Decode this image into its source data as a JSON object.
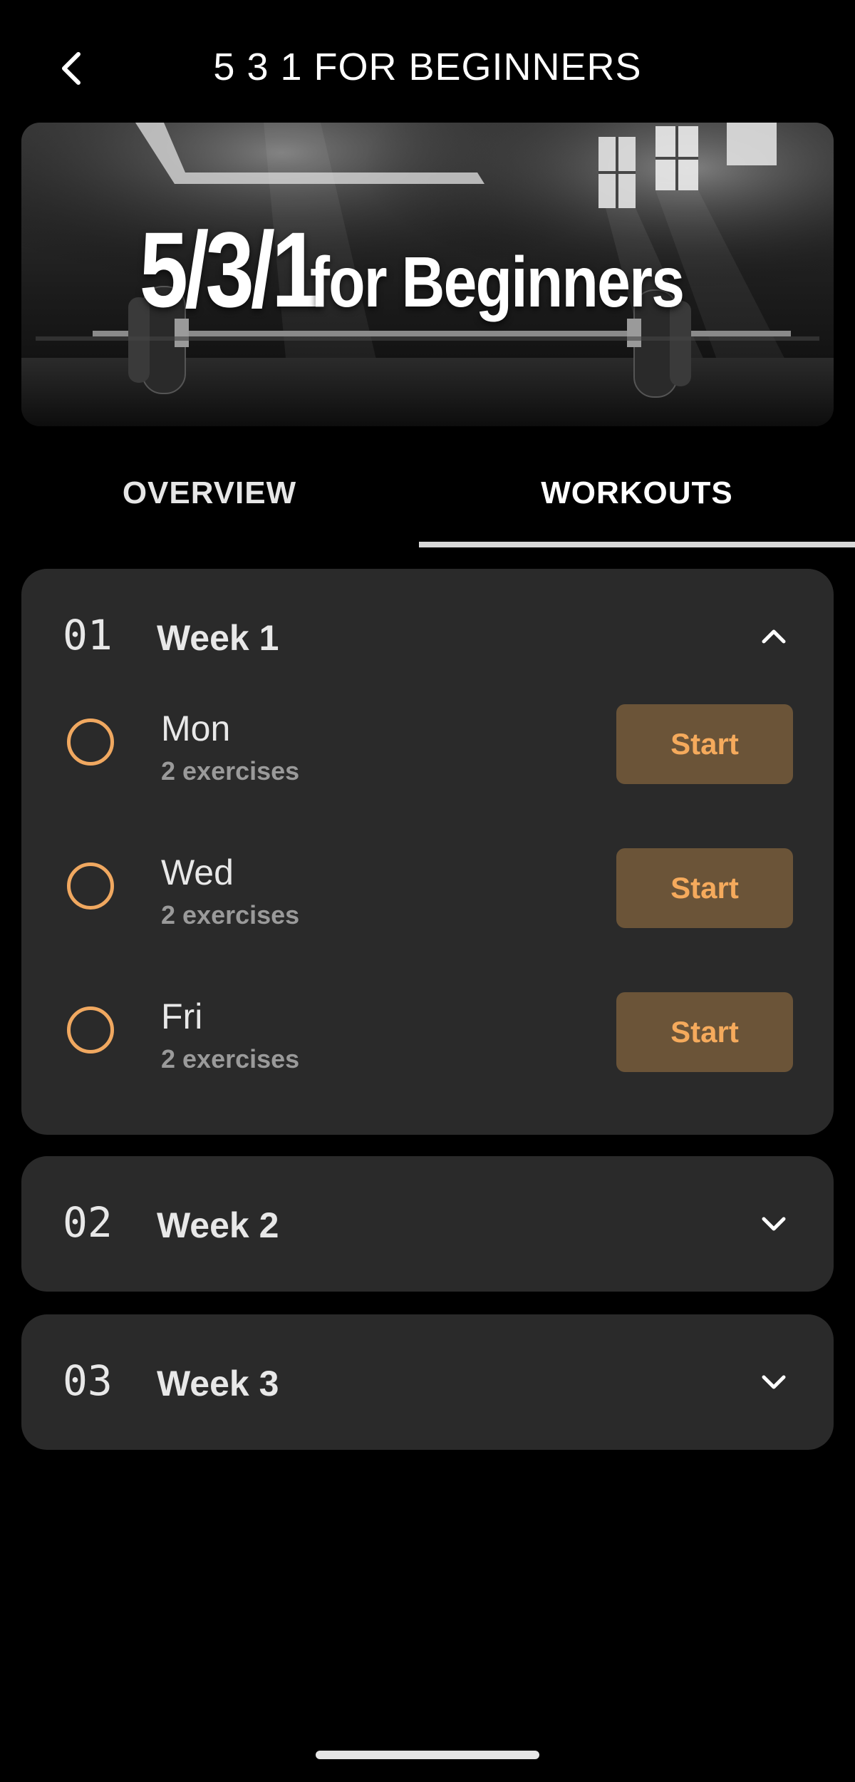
{
  "header": {
    "title": "5 3 1 FOR BEGINNERS",
    "back_icon": "chevron-left-icon"
  },
  "banner": {
    "big_text": "5/3/1",
    "small_text": "for Beginners",
    "image": "barbell-gym-photo"
  },
  "tabs": [
    {
      "label": "OVERVIEW",
      "selected": false
    },
    {
      "label": "WORKOUTS",
      "selected": true
    }
  ],
  "weeks": [
    {
      "number": "01",
      "label": "Week 1",
      "expanded": true,
      "chevron_icon": "chevron-up-icon",
      "days": [
        {
          "name": "Mon",
          "subtitle": "2 exercises",
          "button": "Start"
        },
        {
          "name": "Wed",
          "subtitle": "2 exercises",
          "button": "Start"
        },
        {
          "name": "Fri",
          "subtitle": "2 exercises",
          "button": "Start"
        }
      ]
    },
    {
      "number": "02",
      "label": "Week 2",
      "expanded": false,
      "chevron_icon": "chevron-down-icon"
    },
    {
      "number": "03",
      "label": "Week 3",
      "expanded": false,
      "chevron_icon": "chevron-down-icon"
    }
  ],
  "colors": {
    "background": "#000000",
    "card": "#2a2a2a",
    "accent": "#f0a860",
    "button_bg": "#6b5438",
    "button_text": "#f5aa5c",
    "subtle_text": "#9a9a9a"
  }
}
